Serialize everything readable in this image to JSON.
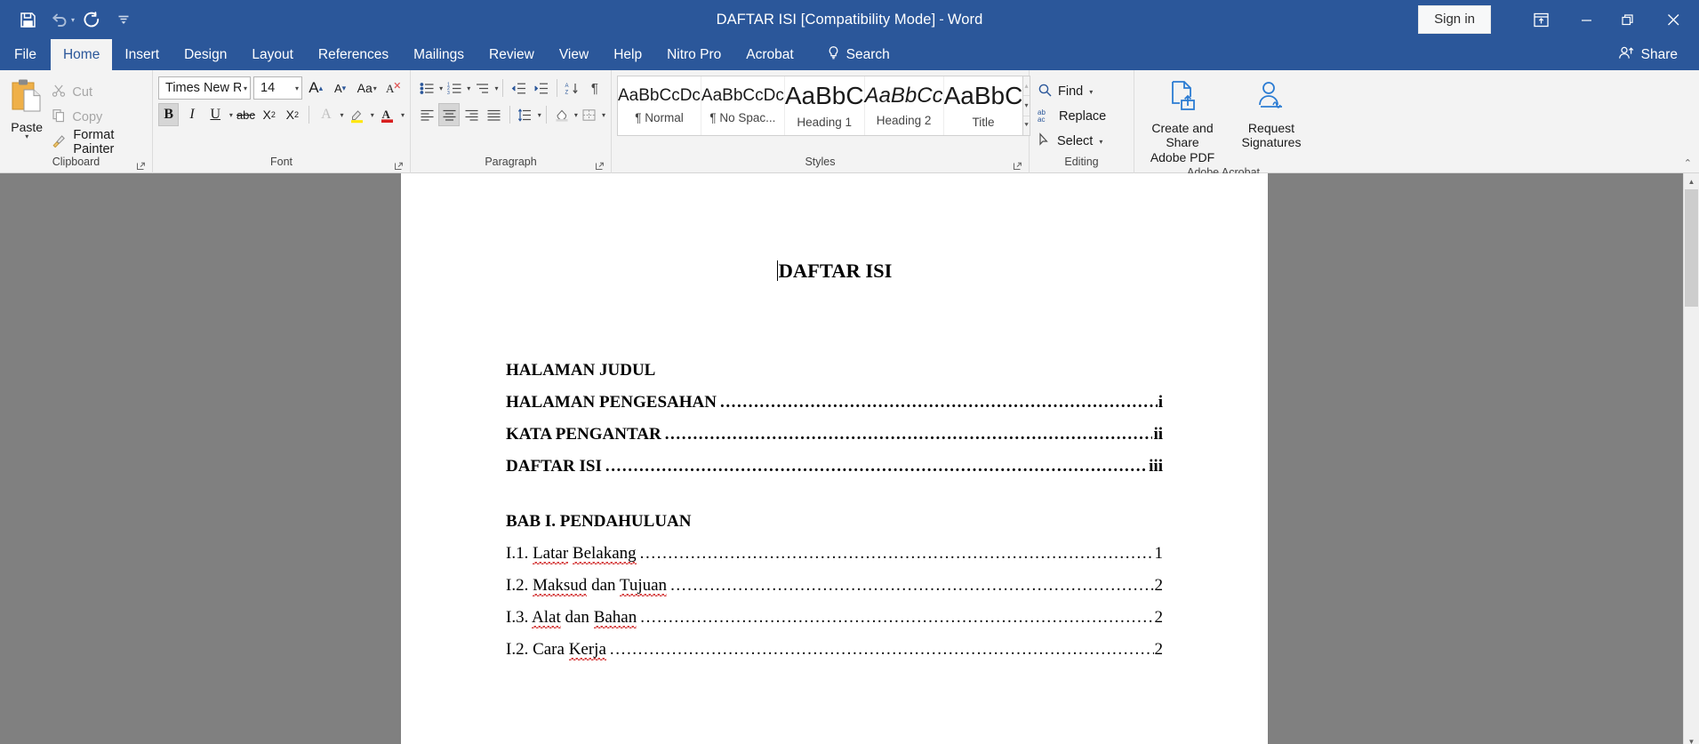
{
  "titlebar": {
    "document_title": "DAFTAR ISI [Compatibility Mode]",
    "separator": "-",
    "app_name": "Word",
    "signin_label": "Sign in",
    "qat": [
      {
        "name": "save-icon",
        "label": "Save"
      },
      {
        "name": "undo-icon",
        "label": "Undo"
      },
      {
        "name": "redo-icon",
        "label": "Redo"
      },
      {
        "name": "customize-qat-icon",
        "label": "Customize Quick Access Toolbar"
      }
    ],
    "window_controls": [
      {
        "name": "ribbon-display-options-icon",
        "label": "Ribbon Display Options"
      },
      {
        "name": "minimize-icon",
        "label": "Minimize"
      },
      {
        "name": "restore-icon",
        "label": "Restore Down"
      },
      {
        "name": "close-icon",
        "label": "Close"
      }
    ],
    "accent_color": "#2b579a"
  },
  "tabs": [
    {
      "label": "File",
      "active": false
    },
    {
      "label": "Home",
      "active": true
    },
    {
      "label": "Insert",
      "active": false
    },
    {
      "label": "Design",
      "active": false
    },
    {
      "label": "Layout",
      "active": false
    },
    {
      "label": "References",
      "active": false
    },
    {
      "label": "Mailings",
      "active": false
    },
    {
      "label": "Review",
      "active": false
    },
    {
      "label": "View",
      "active": false
    },
    {
      "label": "Help",
      "active": false
    },
    {
      "label": "Nitro Pro",
      "active": false
    },
    {
      "label": "Acrobat",
      "active": false
    }
  ],
  "search": {
    "label": "Search",
    "icon": "lightbulb-icon"
  },
  "share": {
    "label": "Share",
    "icon": "share-person-icon"
  },
  "ribbon": {
    "clipboard": {
      "group_label": "Clipboard",
      "paste_label": "Paste",
      "cut_label": "Cut",
      "copy_label": "Copy",
      "format_painter_label": "Format Painter"
    },
    "font": {
      "group_label": "Font",
      "font_name": "Times New R",
      "font_size": "14",
      "grow_label": "Increase Font Size",
      "shrink_label": "Decrease Font Size",
      "change_case_label": "Aa",
      "clear_formatting_label": "Clear All Formatting",
      "bold_label": "B",
      "italic_label": "I",
      "underline_label": "U",
      "strike_label": "abc",
      "subscript_label": "X",
      "superscript_label": "X",
      "bold_active": true
    },
    "paragraph": {
      "group_label": "Paragraph",
      "align_center_active": true
    },
    "styles": {
      "group_label": "Styles",
      "items": [
        {
          "preview": "AaBbCcDc",
          "name": "¶ Normal",
          "size": "19px",
          "weight": "normal",
          "style": "normal"
        },
        {
          "preview": "AaBbCcDc",
          "name": "¶ No Spac...",
          "size": "19px",
          "weight": "normal",
          "style": "normal"
        },
        {
          "preview": "AaBbC",
          "name": "Heading 1",
          "size": "28px",
          "weight": "normal",
          "style": "normal"
        },
        {
          "preview": "AaBbCc",
          "name": "Heading 2",
          "size": "24px",
          "weight": "normal",
          "style": "italic"
        },
        {
          "preview": "AaBbC",
          "name": "Title",
          "size": "28px",
          "weight": "normal",
          "style": "normal"
        }
      ]
    },
    "editing": {
      "group_label": "Editing",
      "find_label": "Find",
      "replace_label": "Replace",
      "select_label": "Select"
    },
    "acrobat": {
      "group_label": "Adobe Acrobat",
      "create_share_line1": "Create and Share",
      "create_share_line2": "Adobe PDF",
      "request_line1": "Request",
      "request_line2": "Signatures"
    }
  },
  "document": {
    "title": "DAFTAR ISI",
    "entries": [
      {
        "label": "HALAMAN JUDUL",
        "page": "",
        "bold": true,
        "leader": false,
        "gap_after": false
      },
      {
        "label": "HALAMAN PENGESAHAN",
        "page": "i",
        "bold": true,
        "leader": true,
        "gap_after": false
      },
      {
        "label": "KATA PENGANTAR",
        "page": "ii",
        "bold": true,
        "leader": true,
        "gap_after": false
      },
      {
        "label": "DAFTAR ISI",
        "page": "iii",
        "bold": true,
        "leader": true,
        "gap_after": true
      },
      {
        "label": "BAB I. PENDAHULUAN",
        "page": "",
        "bold": true,
        "leader": false,
        "gap_after": false
      },
      {
        "label": "I.1. Latar Belakang",
        "page": "1",
        "bold": false,
        "leader": true,
        "gap_after": false,
        "spell": [
          "Latar",
          "Belakang"
        ]
      },
      {
        "label": "I.2. Maksud dan Tujuan",
        "page": "2",
        "bold": false,
        "leader": true,
        "gap_after": false,
        "spell": [
          "Maksud",
          "Tujuan"
        ]
      },
      {
        "label": "I.3. Alat dan Bahan",
        "page": "2",
        "bold": false,
        "leader": true,
        "gap_after": false,
        "spell": [
          "Alat",
          "Bahan"
        ]
      },
      {
        "label": "I.2. Cara Kerja",
        "page": "2",
        "bold": false,
        "leader": true,
        "gap_after": false,
        "spell": [
          "Kerja"
        ]
      }
    ]
  }
}
